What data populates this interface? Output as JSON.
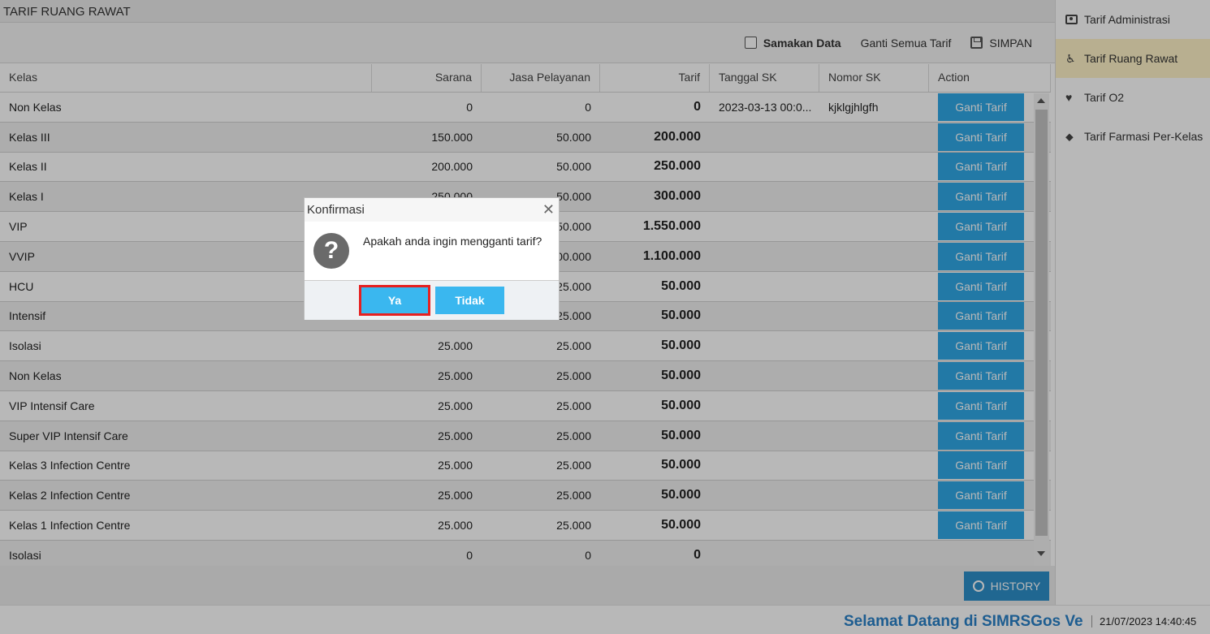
{
  "header": {
    "title": "TARIF RUANG RAWAT"
  },
  "toolbar": {
    "samakan_label": "Samakan Data",
    "ganti_semua_label": "Ganti Semua Tarif",
    "simpan_label": "SIMPAN"
  },
  "table": {
    "columns": [
      "Kelas",
      "Sarana",
      "Jasa Pelayanan",
      "Tarif",
      "Tanggal SK",
      "Nomor SK",
      "Action"
    ],
    "action_label": "Ganti Tarif",
    "rows": [
      {
        "kelas": "Non Kelas",
        "sarana": "0",
        "jasa": "0",
        "tarif": "0",
        "tanggal": "2023-03-13 00:0...",
        "nomor": "kjklgjhlgfh"
      },
      {
        "kelas": "Kelas III",
        "sarana": "150.000",
        "jasa": "50.000",
        "tarif": "200.000",
        "tanggal": "",
        "nomor": ""
      },
      {
        "kelas": "Kelas II",
        "sarana": "200.000",
        "jasa": "50.000",
        "tarif": "250.000",
        "tanggal": "",
        "nomor": ""
      },
      {
        "kelas": "Kelas I",
        "sarana": "250.000",
        "jasa": "50.000",
        "tarif": "300.000",
        "tanggal": "",
        "nomor": ""
      },
      {
        "kelas": "VIP",
        "sarana": "",
        "jasa": "50.000",
        "tarif": "1.550.000",
        "tanggal": "",
        "nomor": ""
      },
      {
        "kelas": "VVIP",
        "sarana": "",
        "jasa": "00.000",
        "tarif": "1.100.000",
        "tanggal": "",
        "nomor": ""
      },
      {
        "kelas": "HCU",
        "sarana": "",
        "jasa": "25.000",
        "tarif": "50.000",
        "tanggal": "",
        "nomor": ""
      },
      {
        "kelas": "Intensif",
        "sarana": "",
        "jasa": "25.000",
        "tarif": "50.000",
        "tanggal": "",
        "nomor": ""
      },
      {
        "kelas": "Isolasi",
        "sarana": "25.000",
        "jasa": "25.000",
        "tarif": "50.000",
        "tanggal": "",
        "nomor": ""
      },
      {
        "kelas": "Non Kelas",
        "sarana": "25.000",
        "jasa": "25.000",
        "tarif": "50.000",
        "tanggal": "",
        "nomor": ""
      },
      {
        "kelas": "VIP Intensif Care",
        "sarana": "25.000",
        "jasa": "25.000",
        "tarif": "50.000",
        "tanggal": "",
        "nomor": ""
      },
      {
        "kelas": "Super VIP Intensif Care",
        "sarana": "25.000",
        "jasa": "25.000",
        "tarif": "50.000",
        "tanggal": "",
        "nomor": ""
      },
      {
        "kelas": "Kelas 3 Infection Centre",
        "sarana": "25.000",
        "jasa": "25.000",
        "tarif": "50.000",
        "tanggal": "",
        "nomor": ""
      },
      {
        "kelas": "Kelas 2 Infection Centre",
        "sarana": "25.000",
        "jasa": "25.000",
        "tarif": "50.000",
        "tanggal": "",
        "nomor": ""
      },
      {
        "kelas": "Kelas 1 Infection Centre",
        "sarana": "25.000",
        "jasa": "25.000",
        "tarif": "50.000",
        "tanggal": "",
        "nomor": ""
      },
      {
        "kelas": "Isolasi",
        "sarana": "0",
        "jasa": "0",
        "tarif": "0",
        "tanggal": "",
        "nomor": ""
      }
    ]
  },
  "history_label": "HISTORY",
  "sidebar": {
    "items": [
      {
        "label": "Tarif Administrasi",
        "icon": "money-icon"
      },
      {
        "label": "Tarif Ruang Rawat",
        "icon": "wheelchair-icon"
      },
      {
        "label": "Tarif O2",
        "icon": "heart-icon"
      },
      {
        "label": "Tarif Farmasi Per-Kelas",
        "icon": "tags-icon"
      }
    ]
  },
  "dialog": {
    "title": "Konfirmasi",
    "message": "Apakah anda ingin mengganti tarif?",
    "yes_label": "Ya",
    "no_label": "Tidak"
  },
  "footer": {
    "welcome": "Selamat Datang di SIMRSGos Ve",
    "datetime": "21/07/2023 14:40:45"
  }
}
